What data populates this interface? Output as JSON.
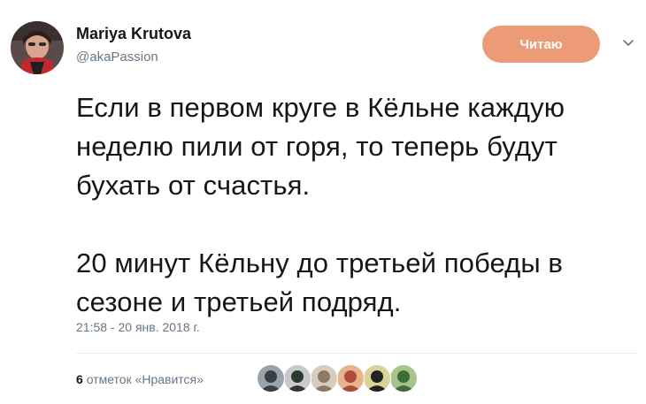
{
  "author": {
    "display_name": "Mariya Krutova",
    "handle": "@akaPassion"
  },
  "follow_button": {
    "label": "Читаю",
    "color": "#ed9a77"
  },
  "tweet": {
    "paragraphs": [
      "Если в первом круге в Кёльне каждую неделю пили от горя, то теперь будут бухать от счастья.",
      "20 минут Кёльну до третьей победы в сезоне и третьей подряд."
    ],
    "timestamp": "21:58 - 20 янв. 2018 г."
  },
  "engagement": {
    "likes_count": "6",
    "likes_label": "отметок «Нравится»",
    "liker_avatars": [
      {
        "name": "liker-avatar-1",
        "colors": [
          "#3a3f44",
          "#9aa3aa"
        ]
      },
      {
        "name": "liker-avatar-2",
        "colors": [
          "#2e3a2e",
          "#c9c9c9"
        ]
      },
      {
        "name": "liker-avatar-3",
        "colors": [
          "#8a7a66",
          "#d8cdbd"
        ]
      },
      {
        "name": "liker-avatar-4",
        "colors": [
          "#b04a3a",
          "#e8b48a"
        ]
      },
      {
        "name": "liker-avatar-5",
        "colors": [
          "#222222",
          "#d9d39a"
        ]
      },
      {
        "name": "liker-avatar-6",
        "colors": [
          "#3f6a3a",
          "#a7c48a"
        ]
      }
    ]
  }
}
